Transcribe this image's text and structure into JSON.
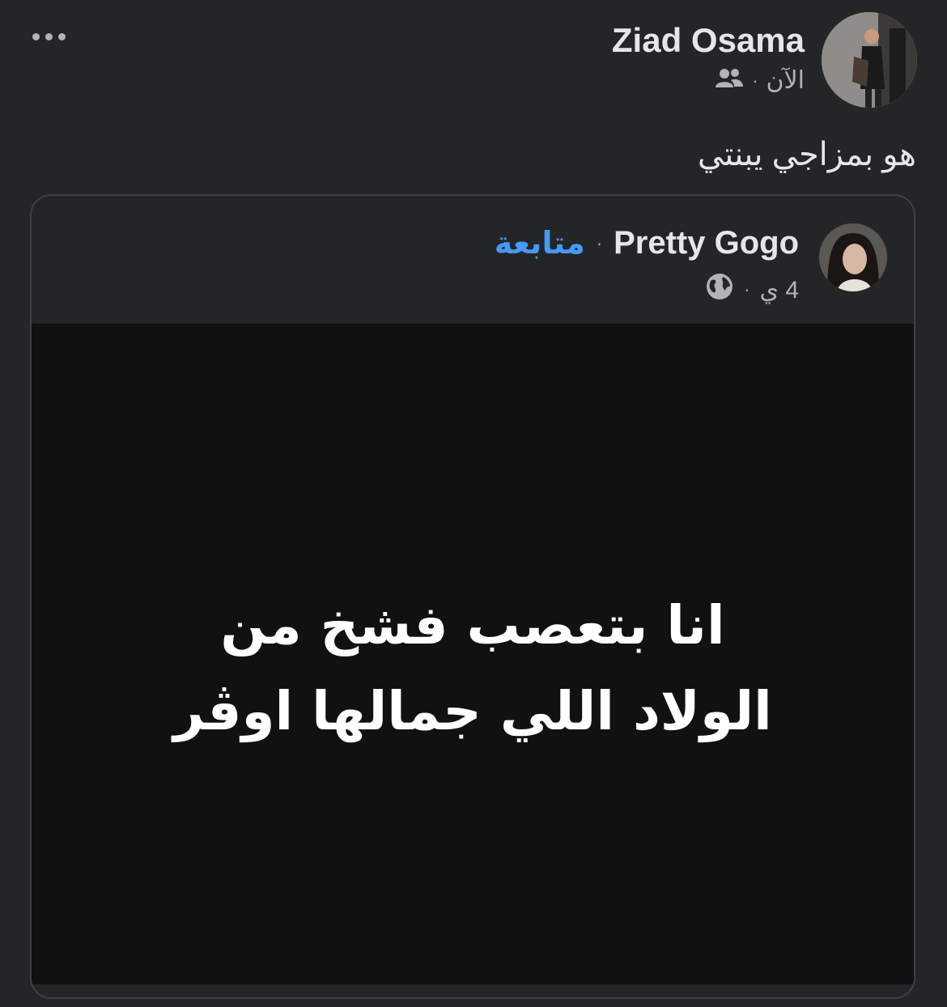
{
  "post": {
    "more_icon": "more-horizontal-icon",
    "author_name": "Ziad Osama",
    "timestamp": "الآن",
    "audience_icon": "friends-icon",
    "text": "هو بمزاجي يبنتي"
  },
  "shared": {
    "author_name": "Pretty Gogo",
    "follow_label": "متابعة",
    "timestamp": "4 ي",
    "audience_icon": "globe-icon",
    "image_text_line1": "انا بتعصب فشخ من",
    "image_text_line2": "الولاد اللي جمالها اوڤر"
  },
  "colors": {
    "background": "#242526",
    "image_background": "#111111",
    "link": "#4599ff",
    "secondary_text": "#b0b3b8"
  }
}
